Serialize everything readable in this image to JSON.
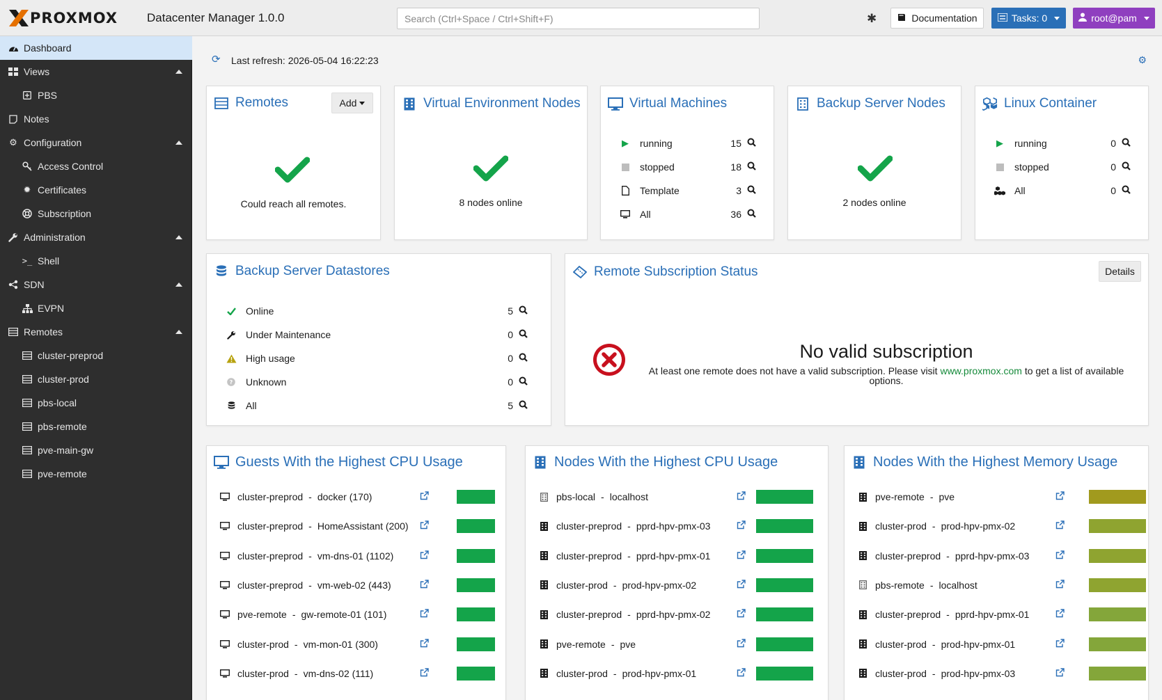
{
  "header": {
    "brand": "PROXMOX",
    "product": "Datacenter Manager 1.0.0",
    "search_placeholder": "Search (Ctrl+Space / Ctrl+Shift+F)",
    "documentation_label": "Documentation",
    "tasks_label": "Tasks: 0",
    "user_label": "root@pam",
    "colors": {
      "tasks": "#2a6fb7",
      "user": "#8f3fbf",
      "logo_accent": "#e57000"
    }
  },
  "sidebar": {
    "items": [
      {
        "label": "Dashboard",
        "icon": "dashboard-icon"
      },
      {
        "label": "Views",
        "icon": "views-icon"
      },
      {
        "label": "PBS",
        "icon": "plus-square-icon"
      },
      {
        "label": "Notes",
        "icon": "notes-icon"
      },
      {
        "label": "Configuration",
        "icon": "cogs-icon"
      },
      {
        "label": "Access Control",
        "icon": "key-icon"
      },
      {
        "label": "Certificates",
        "icon": "certificate-icon"
      },
      {
        "label": "Subscription",
        "icon": "lifebuoy-icon"
      },
      {
        "label": "Administration",
        "icon": "wrench-icon"
      },
      {
        "label": "Shell",
        "icon": "terminal-icon"
      },
      {
        "label": "SDN",
        "icon": "sdn-icon"
      },
      {
        "label": "EVPN",
        "icon": "sitemap-icon"
      },
      {
        "label": "Remotes",
        "icon": "server-icon"
      },
      {
        "label": "cluster-preprod",
        "icon": "server-icon"
      },
      {
        "label": "cluster-prod",
        "icon": "server-icon"
      },
      {
        "label": "pbs-local",
        "icon": "server-icon"
      },
      {
        "label": "pbs-remote",
        "icon": "server-icon"
      },
      {
        "label": "pve-main-gw",
        "icon": "server-icon"
      },
      {
        "label": "pve-remote",
        "icon": "server-icon"
      }
    ]
  },
  "dashboard": {
    "last_refresh": "Last refresh: 2026-05-04 16:22:23",
    "remotes": {
      "title": "Remotes",
      "add_label": "Add",
      "status": "Could reach all remotes."
    },
    "ve_nodes": {
      "title": "Virtual Environment Nodes",
      "status": "8 nodes online"
    },
    "vms": {
      "title": "Virtual Machines",
      "rows": [
        {
          "label": "running",
          "value": "15"
        },
        {
          "label": "stopped",
          "value": "18"
        },
        {
          "label": "Template",
          "value": "3"
        },
        {
          "label": "All",
          "value": "36"
        }
      ]
    },
    "backup_nodes": {
      "title": "Backup Server Nodes",
      "status": "2 nodes online"
    },
    "lxc": {
      "title": "Linux Container",
      "rows": [
        {
          "label": "running",
          "value": "0"
        },
        {
          "label": "stopped",
          "value": "0"
        },
        {
          "label": "All",
          "value": "0"
        }
      ]
    },
    "datastores": {
      "title": "Backup Server Datastores",
      "rows": [
        {
          "label": "Online",
          "value": "5"
        },
        {
          "label": "Under Maintenance",
          "value": "0"
        },
        {
          "label": "High usage",
          "value": "0"
        },
        {
          "label": "Unknown",
          "value": "0"
        },
        {
          "label": "All",
          "value": "5"
        }
      ]
    },
    "subscription": {
      "title": "Remote Subscription Status",
      "details_label": "Details",
      "heading": "No valid subscription",
      "text_before": "At least one remote does not have a valid subscription. Please visit",
      "link": "www.proxmox.com",
      "text_after": "to get a list of available options."
    },
    "guests_cpu": {
      "title": "Guests With the Highest CPU Usage",
      "rows": [
        {
          "remote": "cluster-preprod",
          "name": "docker (170)"
        },
        {
          "remote": "cluster-preprod",
          "name": "HomeAssistant (200)"
        },
        {
          "remote": "cluster-preprod",
          "name": "vm-dns-01 (1102)"
        },
        {
          "remote": "cluster-preprod",
          "name": "vm-web-02 (443)"
        },
        {
          "remote": "pve-remote",
          "name": "gw-remote-01 (101)"
        },
        {
          "remote": "cluster-prod",
          "name": "vm-mon-01 (300)"
        },
        {
          "remote": "cluster-prod",
          "name": "vm-dns-02 (111)"
        }
      ],
      "bar_color": "#14a44a"
    },
    "nodes_cpu": {
      "title": "Nodes With the Highest CPU Usage",
      "rows": [
        {
          "remote": "pbs-local",
          "name": "localhost"
        },
        {
          "remote": "cluster-preprod",
          "name": "pprd-hpv-pmx-03"
        },
        {
          "remote": "cluster-preprod",
          "name": "pprd-hpv-pmx-01"
        },
        {
          "remote": "cluster-prod",
          "name": "prod-hpv-pmx-02"
        },
        {
          "remote": "cluster-preprod",
          "name": "pprd-hpv-pmx-02"
        },
        {
          "remote": "pve-remote",
          "name": "pve"
        },
        {
          "remote": "cluster-prod",
          "name": "prod-hpv-pmx-01"
        }
      ],
      "bar_color": "#14a44a"
    },
    "nodes_mem": {
      "title": "Nodes With the Highest Memory Usage",
      "rows": [
        {
          "remote": "pve-remote",
          "name": "pve",
          "color": "#a19a1e"
        },
        {
          "remote": "cluster-prod",
          "name": "prod-hpv-pmx-02",
          "color": "#8fa430"
        },
        {
          "remote": "cluster-preprod",
          "name": "pprd-hpv-pmx-03",
          "color": "#8fa430"
        },
        {
          "remote": "pbs-remote",
          "name": "localhost",
          "color": "#8fa430"
        },
        {
          "remote": "cluster-preprod",
          "name": "pprd-hpv-pmx-01",
          "color": "#84a63a"
        },
        {
          "remote": "cluster-prod",
          "name": "prod-hpv-pmx-01",
          "color": "#84a63a"
        },
        {
          "remote": "cluster-prod",
          "name": "prod-hpv-pmx-03",
          "color": "#84a63a"
        }
      ]
    }
  }
}
